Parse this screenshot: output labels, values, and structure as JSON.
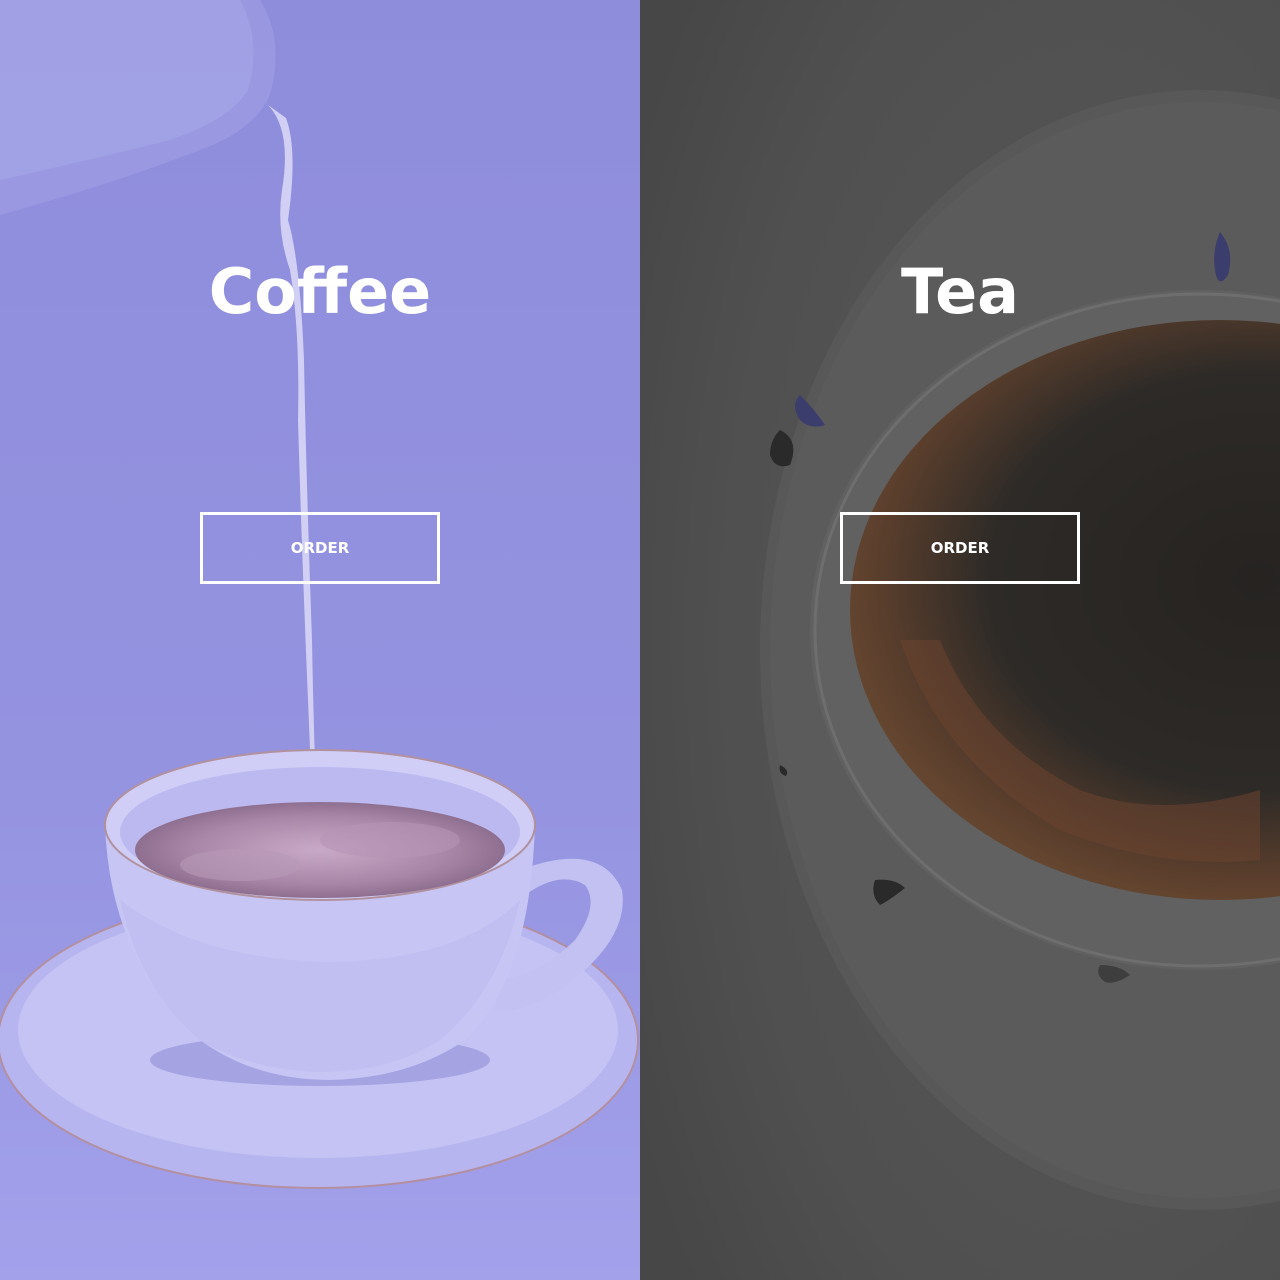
{
  "panels": [
    {
      "title": "Coffee",
      "button_label": "ORDER",
      "overlay_color": "#8f8ddd",
      "image": "coffee-cup-milk-pour-photo"
    },
    {
      "title": "Tea",
      "button_label": "ORDER",
      "overlay_color": "#4f4f4f",
      "image": "tea-cup-top-view-photo"
    }
  ]
}
